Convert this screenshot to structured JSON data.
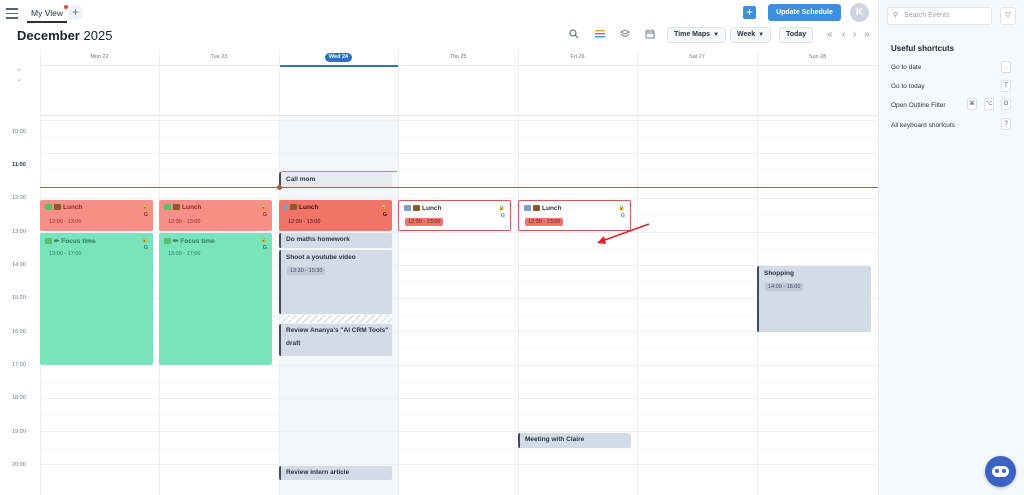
{
  "header": {
    "view_tab_label": "My View",
    "add_view_label": "+",
    "month": "December",
    "year": "2025",
    "time_maps_label": "Time Maps",
    "week_label": "Week",
    "today_label": "Today",
    "update_schedule_label": "Update Schedule",
    "add_label": "+",
    "avatar_initial": "K"
  },
  "days": [
    {
      "label": "Mon 22"
    },
    {
      "label": "Tue 23"
    },
    {
      "label": "Wed 24",
      "today": true
    },
    {
      "label": "Thu 25"
    },
    {
      "label": "Fri 26"
    },
    {
      "label": "Sat 27"
    },
    {
      "label": "Sun 28"
    }
  ],
  "times": [
    "10:00",
    "11:00",
    "12:00",
    "13:00",
    "14:00",
    "15:00",
    "16:00",
    "17:00",
    "18:00",
    "19:00",
    "20:00"
  ],
  "events": {
    "lunch_title": "Lunch",
    "lunch_time": "12:00 - 13:00",
    "focus_title": "Focus time",
    "focus_time": "13:00 - 17:00",
    "call_mom": "Call mom",
    "maths": "Do maths homework",
    "youtube_title": "Shoot a youtube video",
    "youtube_time": "13:30 - 15:30",
    "review_title_1": "Review Ananya's \"AI CRM Tools\"",
    "review_title_2": "draft",
    "review_intern": "Review intern article",
    "meeting_claire": "Meeting with Claire",
    "shopping_title": "Shopping",
    "shopping_time": "14:00 - 16:00",
    "google_mark": "G"
  },
  "sidebar": {
    "search_placeholder": "Search Events",
    "title": "Useful shortcuts",
    "shortcuts": [
      {
        "label": "Go to date",
        "keys": [
          "."
        ]
      },
      {
        "label": "Go to today",
        "keys": [
          "T"
        ]
      },
      {
        "label": "Open Outline Filter",
        "keys": [
          "⌘",
          "⌥",
          "O"
        ]
      },
      {
        "label": "All keyboard shortcuts",
        "keys": [
          "?"
        ]
      }
    ]
  },
  "colors": {
    "accent": "#3d8fe0",
    "lunch": "#f68f85",
    "focus": "#78e3bc",
    "task": "#d3dbe6",
    "now_line": "#c9504a"
  }
}
